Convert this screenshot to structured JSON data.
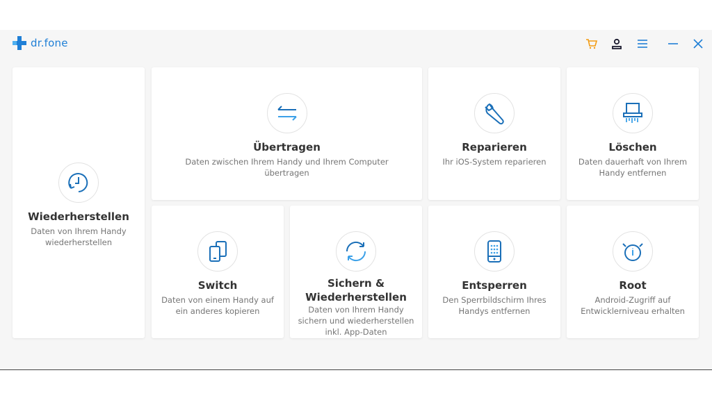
{
  "app": {
    "name": "dr.fone",
    "accent": "#1f7fd6",
    "cart_color": "#f39c12"
  },
  "toolbar": {
    "icons": [
      "cart-icon",
      "user-icon",
      "menu-icon",
      "minimize-icon",
      "close-icon"
    ]
  },
  "cards": {
    "recover": {
      "title": "Wiederherstellen",
      "desc": "Daten von Ihrem Handy wiederherstellen",
      "icon": "clock-icon"
    },
    "transfer": {
      "title": "Übertragen",
      "desc": "Daten zwischen Ihrem Handy und Ihrem Computer übertragen",
      "icon": "transfer-arrows-icon"
    },
    "repair": {
      "title": "Reparieren",
      "desc": "Ihr iOS-System reparieren",
      "icon": "wrench-icon"
    },
    "erase": {
      "title": "Löschen",
      "desc": "Daten dauerhaft von Ihrem Handy entfernen",
      "icon": "shredder-icon"
    },
    "switch": {
      "title": "Switch",
      "desc": "Daten von einem Handy auf ein anderes kopieren",
      "icon": "phone-switch-icon"
    },
    "backup": {
      "title": "Sichern & Wiederherstellen",
      "desc": "Daten von Ihrem Handy sichern und wiederherstellen inkl. App-Daten",
      "icon": "sync-icon"
    },
    "unlock": {
      "title": "Entsperren",
      "desc": "Den Sperrbildschirm Ihres Handys entfernen",
      "icon": "phone-unlock-icon"
    },
    "root": {
      "title": "Root",
      "desc": "Android-Zugriff auf Entwicklerniveau erhalten",
      "icon": "root-icon"
    }
  }
}
